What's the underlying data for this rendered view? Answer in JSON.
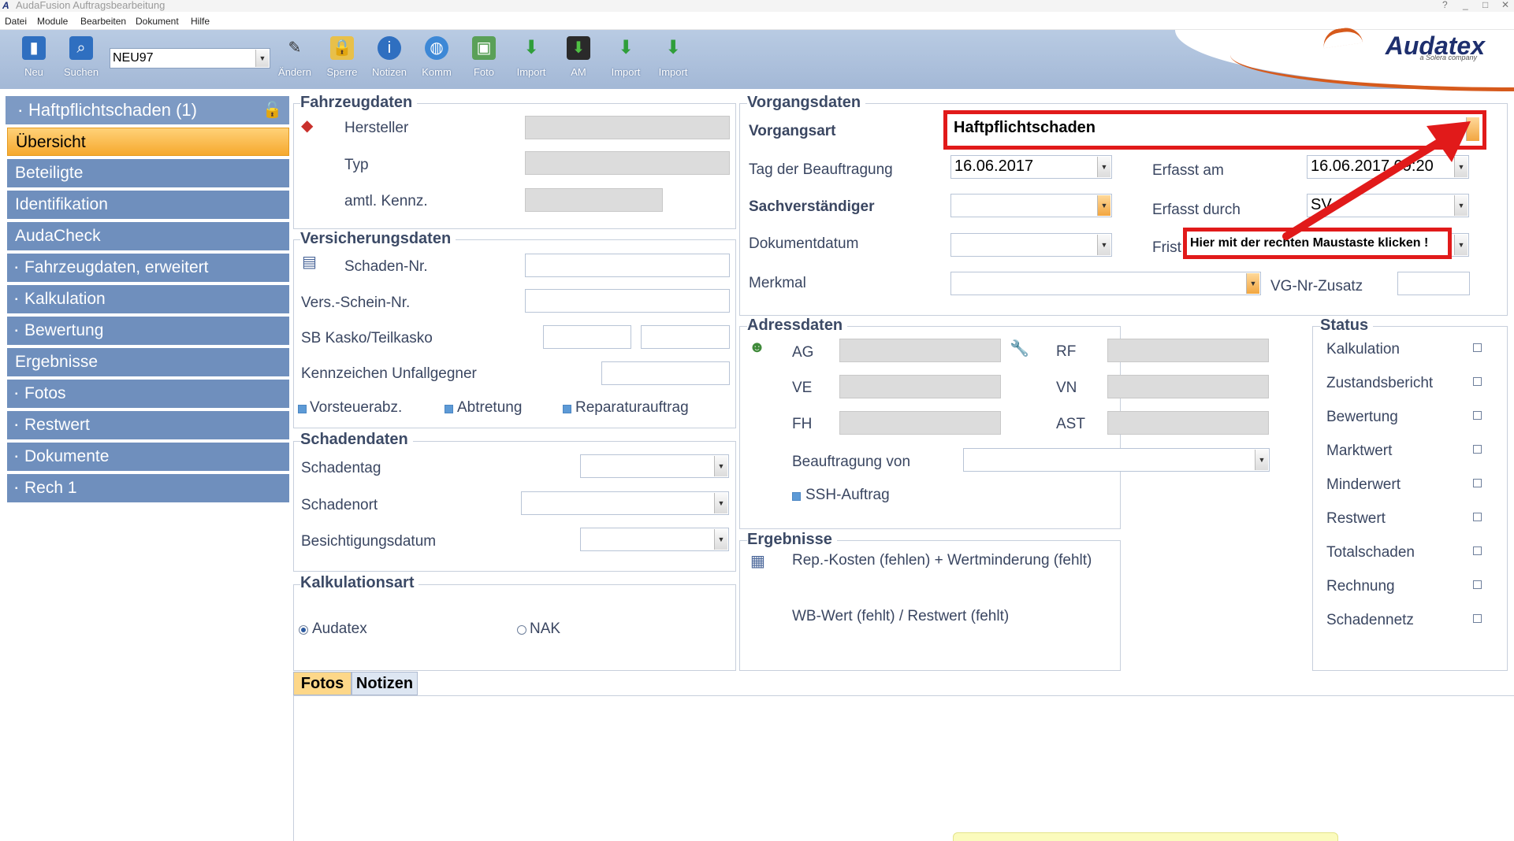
{
  "window": {
    "app_icon": "A",
    "title": "AudaFusion Auftragsbearbeitung",
    "controls": [
      "?",
      "_",
      "□",
      "✕"
    ]
  },
  "menu": [
    "Datei",
    "Module",
    "Bearbeiten",
    "Dokument",
    "Hilfe"
  ],
  "toolbar": {
    "neu": "Neu",
    "suchen": "Suchen",
    "case_value": "NEU97",
    "aendern": "Ändern",
    "sperre": "Sperre",
    "notizen": "Notizen",
    "komm": "Komm",
    "foto": "Foto",
    "import1": "Import",
    "am": "AM",
    "import2": "Import",
    "import3": "Import"
  },
  "brand": {
    "name": "Audatex",
    "tagline": "a Solera company"
  },
  "sidebar": {
    "header": "Haftpflichtschaden (1)",
    "items": [
      {
        "label": "Übersicht",
        "expandable": false,
        "active": true
      },
      {
        "label": "Beteiligte",
        "expandable": false
      },
      {
        "label": "Identifikation",
        "expandable": false
      },
      {
        "label": "AudaCheck",
        "expandable": false
      },
      {
        "label": "Fahrzeugdaten, erweitert",
        "expandable": true
      },
      {
        "label": "Kalkulation",
        "expandable": true
      },
      {
        "label": "Bewertung",
        "expandable": true
      },
      {
        "label": "Ergebnisse",
        "expandable": false
      },
      {
        "label": "Fotos",
        "expandable": true
      },
      {
        "label": "Restwert",
        "expandable": true
      },
      {
        "label": "Dokumente",
        "expandable": true
      },
      {
        "label": "Rech 1",
        "expandable": true
      }
    ]
  },
  "fahrzeug": {
    "title": "Fahrzeugdaten",
    "hersteller": "Hersteller",
    "typ": "Typ",
    "kennz": "amtl. Kennz."
  },
  "versicherung": {
    "title": "Versicherungsdaten",
    "schaden_nr": "Schaden-Nr.",
    "vers_schein": "Vers.-Schein-Nr.",
    "sb_kasko": "SB Kasko/Teilkasko",
    "kennz_gegner": "Kennzeichen Unfallgegner",
    "vorsteuer": "Vorsteuerabz.",
    "abtretung": "Abtretung",
    "reparaturauftrag": "Reparaturauftrag"
  },
  "schaden": {
    "title": "Schadendaten",
    "schadentag": "Schadentag",
    "schadenort": "Schadenort",
    "besichtigung": "Besichtigungsdatum"
  },
  "kalkulationsart": {
    "title": "Kalkulationsart",
    "audatex": "Audatex",
    "nak": "NAK",
    "selected": "Audatex"
  },
  "vorgang": {
    "title": "Vorgangsdaten",
    "vorgangsart_label": "Vorgangsart",
    "vorgangsart_value": "Haftpflichtschaden",
    "tag_label": "Tag der Beauftragung",
    "tag_value": "16.06.2017",
    "erfasst_am_label": "Erfasst am",
    "erfasst_am_value": "16.06.2017 09:20",
    "sv_label": "Sachverständiger",
    "erfasst_durch_label": "Erfasst durch",
    "erfasst_durch_value": "SV",
    "dokdatum_label": "Dokumentdatum",
    "frist_label": "Frist",
    "merkmal_label": "Merkmal",
    "vg_nr_label": "VG-Nr-Zusatz"
  },
  "annotation": {
    "text": "Hier mit der rechten Maustaste klicken !"
  },
  "adress": {
    "title": "Adressdaten",
    "ag": "AG",
    "rf": "RF",
    "ve": "VE",
    "vn": "VN",
    "fh": "FH",
    "ast": "AST",
    "beauftragung": "Beauftragung von",
    "ssh": "SSH-Auftrag"
  },
  "ergebnisse": {
    "title": "Ergebnisse",
    "line1": "Rep.-Kosten (fehlen) + Wertminderung (fehlt)",
    "line2": "WB-Wert (fehlt) / Restwert (fehlt)"
  },
  "status": {
    "title": "Status",
    "items": [
      "Kalkulation",
      "Zustandsbericht",
      "Bewertung",
      "Marktwert",
      "Minderwert",
      "Restwert",
      "Totalschaden",
      "Rechnung",
      "Schadennetz"
    ]
  },
  "tabs": {
    "fotos": "Fotos",
    "notizen": "Notizen"
  },
  "colors": {
    "accent_orange": "#f6a92e",
    "nav_blue": "#6f8fbd",
    "annotation_red": "#e11a1a"
  }
}
